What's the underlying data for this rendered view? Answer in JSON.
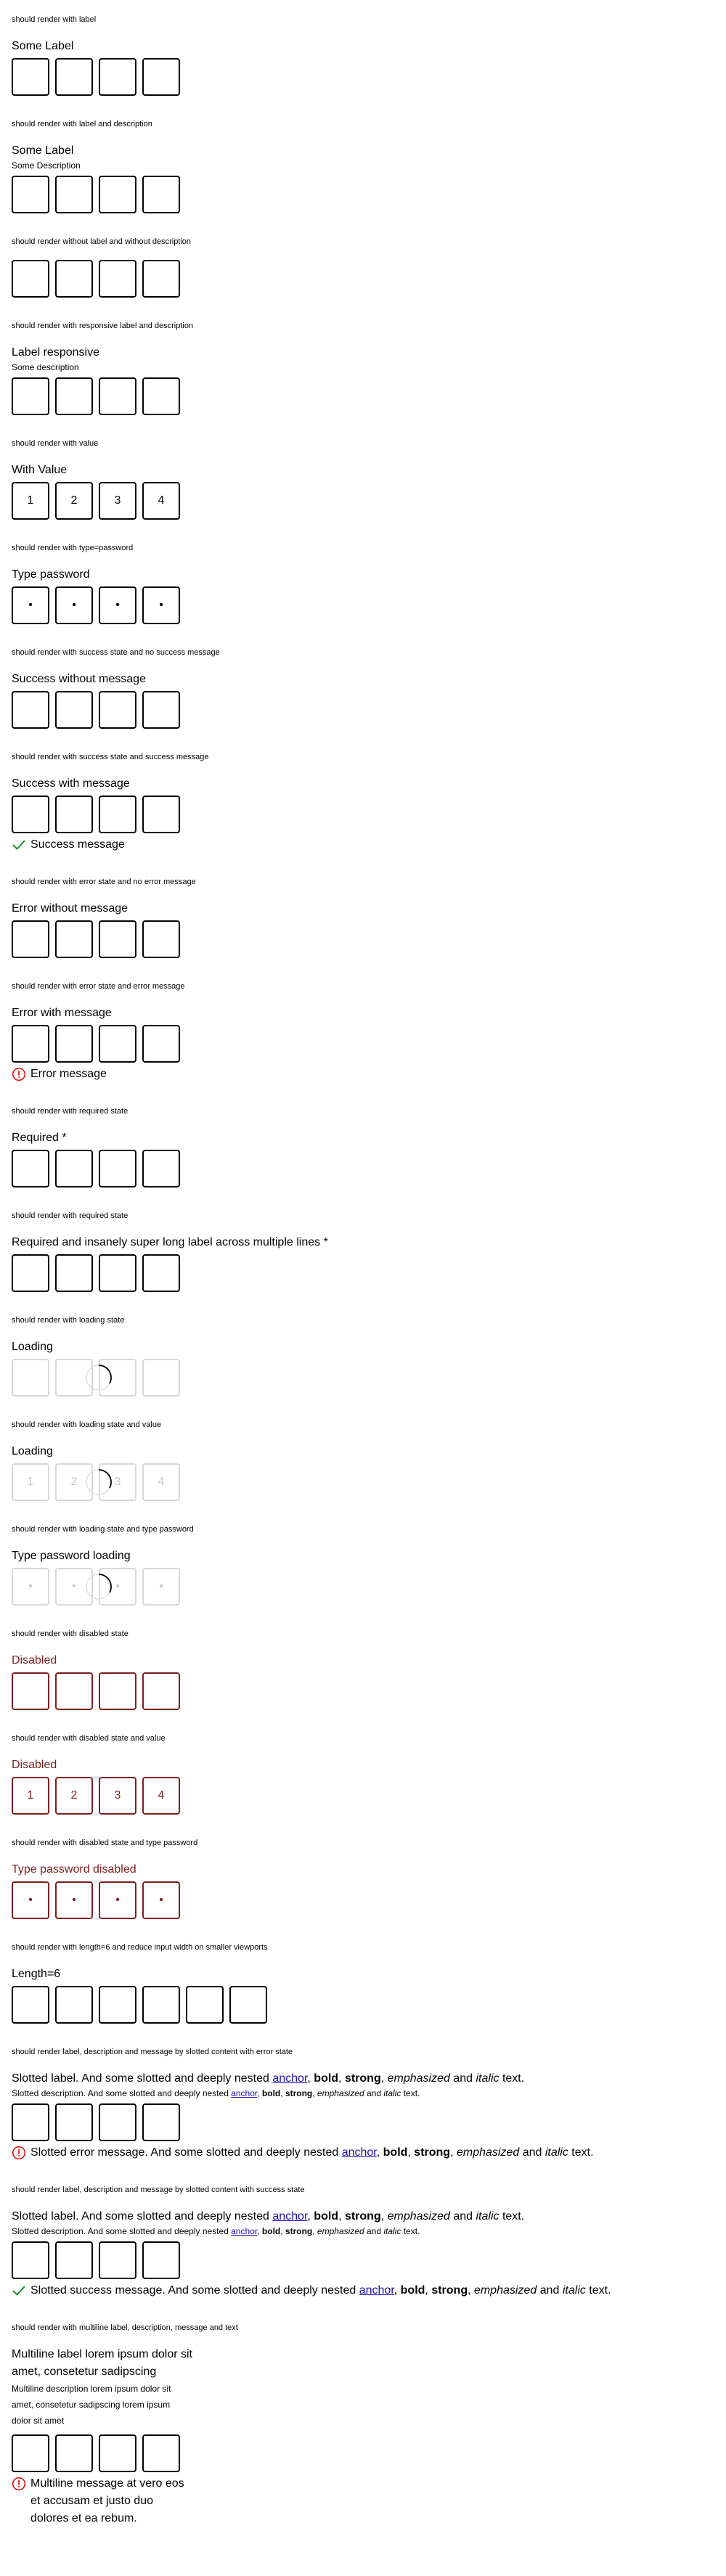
{
  "sections": [
    {
      "caption": "should render with label",
      "label": "Some Label",
      "values": [
        "",
        "",
        "",
        ""
      ]
    },
    {
      "caption": "should render with label and description",
      "label": "Some Label",
      "description": "Some Description",
      "values": [
        "",
        "",
        "",
        ""
      ]
    },
    {
      "caption": "should render without label and without description",
      "values": [
        "",
        "",
        "",
        ""
      ]
    },
    {
      "caption": "should render with responsive label and description",
      "label": "Label responsive",
      "description": "Some description",
      "values": [
        "",
        "",
        "",
        ""
      ]
    },
    {
      "caption": "should render with value",
      "label": "With Value",
      "values": [
        "1",
        "2",
        "3",
        "4"
      ]
    },
    {
      "caption": "should render with type=password",
      "label": "Type password",
      "values": [
        "•",
        "•",
        "•",
        "•"
      ]
    },
    {
      "caption": "should render with success state and no success message",
      "label": "Success without message",
      "values": [
        "",
        "",
        "",
        ""
      ]
    },
    {
      "caption": "should render with success state and success message",
      "label": "Success with message",
      "values": [
        "",
        "",
        "",
        ""
      ],
      "message": "Success message"
    },
    {
      "caption": "should render with error state and no error message",
      "label": "Error without message",
      "values": [
        "",
        "",
        "",
        ""
      ]
    },
    {
      "caption": "should render with error state and error message",
      "label": "Error with message",
      "values": [
        "",
        "",
        "",
        ""
      ],
      "message": "Error message"
    },
    {
      "caption": "should render with required state",
      "label": "Required *",
      "values": [
        "",
        "",
        "",
        ""
      ]
    },
    {
      "caption": "should render with required state",
      "label": "Required and insanely super long label across multiple lines *",
      "values": [
        "",
        "",
        "",
        ""
      ]
    },
    {
      "caption": "should render with loading state",
      "label": "Loading",
      "values": [
        "",
        "",
        "",
        ""
      ]
    },
    {
      "caption": "should render with loading state and value",
      "label": "Loading",
      "values": [
        "1",
        "2",
        "3",
        "4"
      ]
    },
    {
      "caption": "should render with loading state and type password",
      "label": "Type password loading",
      "values": [
        "•",
        "•",
        "•",
        "•"
      ]
    },
    {
      "caption": "should render with disabled state",
      "label": "Disabled",
      "values": [
        "",
        "",
        "",
        ""
      ]
    },
    {
      "caption": "should render with disabled state and value",
      "label": "Disabled",
      "values": [
        "1",
        "2",
        "3",
        "4"
      ]
    },
    {
      "caption": "should render with disabled state and type password",
      "label": "Type password disabled",
      "values": [
        "•",
        "•",
        "•",
        "•"
      ]
    },
    {
      "caption": "should render with length=6 and reduce input width on smaller viewports",
      "label": "Length=6",
      "values": [
        "",
        "",
        "",
        "",
        "",
        ""
      ]
    },
    {
      "caption": "should render label, description and message by slotted content with error state",
      "values": [
        "",
        "",
        "",
        ""
      ]
    },
    {
      "caption": "should render label, description and message by slotted content with success state",
      "values": [
        "",
        "",
        "",
        ""
      ]
    },
    {
      "caption": "should render with multiline label, description, message and text",
      "label": "Multiline label lorem ipsum dolor sit amet, consetetur sadipscing",
      "description": "Multiline description lorem ipsum dolor sit amet, consetetur sadipscing lorem ipsum dolor sit amet",
      "values": [
        "",
        "",
        "",
        ""
      ],
      "message": "Multiline message at vero eos et accusam et justo duo dolores et ea rebum."
    }
  ],
  "slotted": {
    "label_pre": "Slotted label. And some slotted and deeply nested ",
    "desc_pre": "Slotted description. And some slotted and deeply nested ",
    "error_pre": "Slotted error message. And some slotted and deeply nested ",
    "success_pre": "Slotted success message. And some slotted and deeply nested ",
    "anchor": "anchor",
    "comma": ", ",
    "bold": "bold",
    "strong": "strong",
    "emphasized": "emphasized",
    "and": " and ",
    "italic": "italic",
    "text_end": " text."
  },
  "colors": {
    "success": "#018a16",
    "error": "#e00000",
    "disabled": "#7f1e1e",
    "text": "#010205"
  },
  "icons": {
    "success": "check-icon",
    "error": "exclamation-icon",
    "loading": "spinner-icon"
  }
}
